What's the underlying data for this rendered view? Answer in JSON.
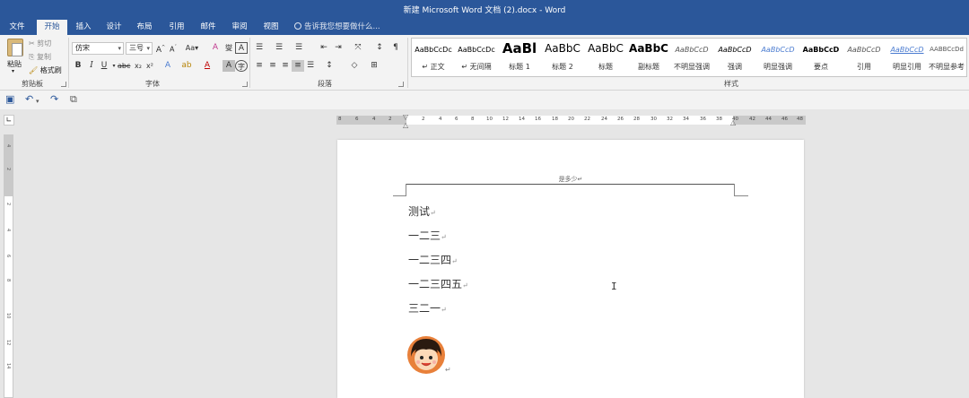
{
  "window": {
    "title": "新建 Microsoft Word 文档 (2).docx - Word"
  },
  "tabs": [
    {
      "label": "文件"
    },
    {
      "label": "开始"
    },
    {
      "label": "插入"
    },
    {
      "label": "设计"
    },
    {
      "label": "布局"
    },
    {
      "label": "引用"
    },
    {
      "label": "邮件"
    },
    {
      "label": "审阅"
    },
    {
      "label": "视图"
    }
  ],
  "active_tab": "开始",
  "tell_me": {
    "placeholder": "告诉我您想要做什么..."
  },
  "clipboard": {
    "paste": "粘贴",
    "cut": "剪切",
    "copy": "复制",
    "format_painter": "格式刷",
    "group_label": "剪贴板"
  },
  "font": {
    "family": "仿宋",
    "size": "三号",
    "change_case": "Aa",
    "group_label": "字体"
  },
  "paragraph": {
    "group_label": "段落"
  },
  "styles": {
    "group_label": "样式",
    "items": [
      {
        "sample": "AaBbCcDc",
        "name": "↵ 正文"
      },
      {
        "sample": "AaBbCcDc",
        "name": "↵ 无间隔"
      },
      {
        "sample": "AaBl",
        "name": "标题 1"
      },
      {
        "sample": "AaBbC",
        "name": "标题 2"
      },
      {
        "sample": "AaBbC",
        "name": "标题"
      },
      {
        "sample": "AaBbC",
        "name": "副标题"
      },
      {
        "sample": "AaBbCcD",
        "name": "不明显强调"
      },
      {
        "sample": "AaBbCcD",
        "name": "强调"
      },
      {
        "sample": "AaBbCcD",
        "name": "明显强调"
      },
      {
        "sample": "AaBbCcD",
        "name": "要点"
      },
      {
        "sample": "AaBbCcD",
        "name": "引用"
      },
      {
        "sample": "AaBbCcD",
        "name": "明显引用"
      },
      {
        "sample": "AABBCcDd",
        "name": "不明显参考"
      }
    ]
  },
  "ruler": {
    "h_numbers": [
      "8",
      "6",
      "4",
      "2",
      "2",
      "4",
      "6",
      "8",
      "10",
      "12",
      "14",
      "16",
      "18",
      "20",
      "22",
      "24",
      "26",
      "28",
      "30",
      "32",
      "34",
      "36",
      "38",
      "40",
      "42",
      "44",
      "46",
      "48"
    ],
    "v_numbers": [
      "4",
      "2",
      "2",
      "4",
      "6",
      "8",
      "10",
      "12",
      "14"
    ]
  },
  "document": {
    "header_text": "是多少↵",
    "lines": [
      "测试",
      "一二三",
      "一二三四",
      "一二三四五",
      "三二一"
    ],
    "paragraph_mark": "↵"
  },
  "colors": {
    "accent": "#2b579a",
    "ribbon_bg": "#f3f3f3",
    "workspace_bg": "#e6e6e6"
  }
}
